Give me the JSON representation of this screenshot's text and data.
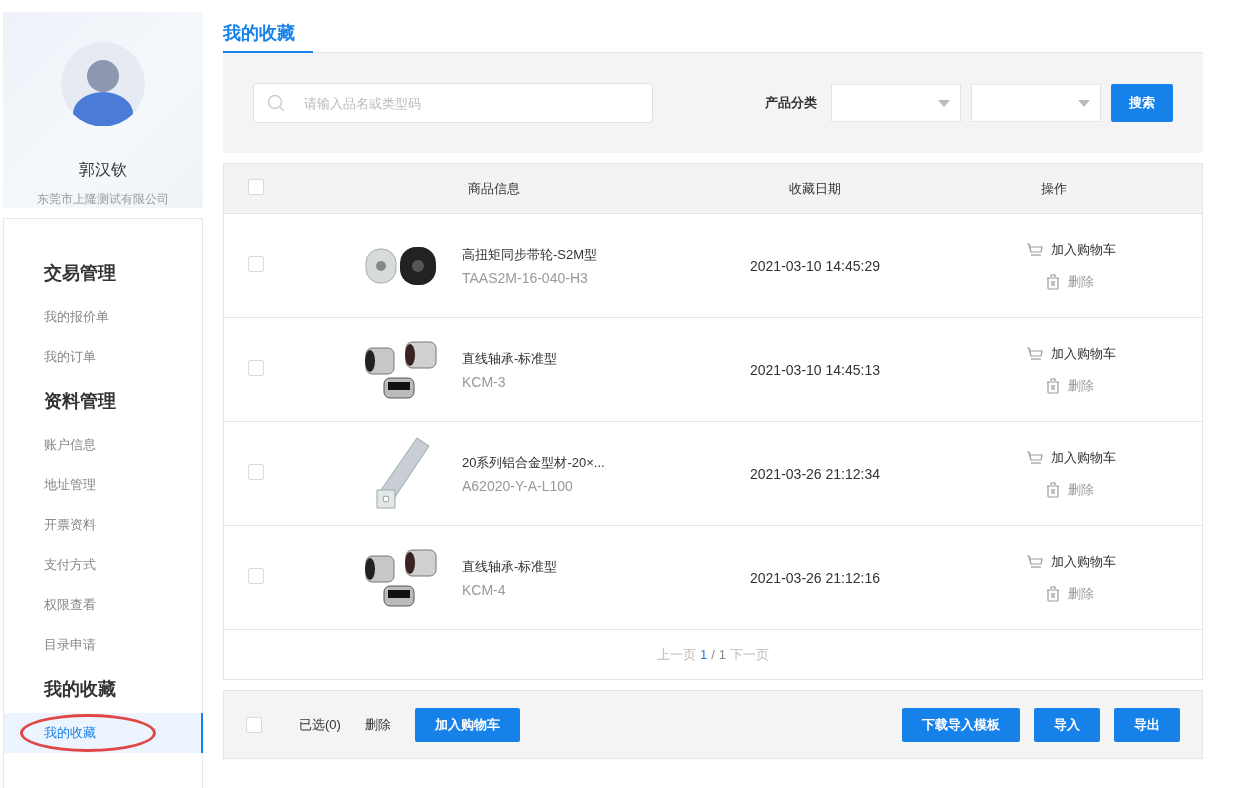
{
  "profile": {
    "name": "郭汉钦",
    "company": "东莞市上隆测试有限公司"
  },
  "menu": [
    {
      "title": "交易管理",
      "items": [
        {
          "label": "我的报价单",
          "selected": false
        },
        {
          "label": "我的订单",
          "selected": false
        }
      ]
    },
    {
      "title": "资料管理",
      "items": [
        {
          "label": "账户信息",
          "selected": false
        },
        {
          "label": "地址管理",
          "selected": false
        },
        {
          "label": "开票资料",
          "selected": false
        },
        {
          "label": "支付方式",
          "selected": false
        },
        {
          "label": "权限查看",
          "selected": false
        },
        {
          "label": "目录申请",
          "selected": false
        }
      ]
    },
    {
      "title": "我的收藏",
      "items": [
        {
          "label": "我的收藏",
          "selected": true,
          "annotated": true
        }
      ]
    }
  ],
  "page_tab": "我的收藏",
  "search": {
    "placeholder": "请输入品名或类型码",
    "category_label": "产品分类",
    "button": "搜索"
  },
  "table": {
    "select_all_checked": false,
    "columns": [
      "商品信息",
      "收藏日期",
      "操作"
    ],
    "rows": [
      {
        "checked": false,
        "kind": "pulley",
        "name": "高扭矩同步带轮-S2M型",
        "code": "TAAS2M-16-040-H3",
        "date": "2021-03-10 14:45:29",
        "add_cart": "加入购物车",
        "delete": "删除"
      },
      {
        "checked": false,
        "kind": "bearing",
        "name": "直线轴承-标准型",
        "code": "KCM-3",
        "date": "2021-03-10 14:45:13",
        "add_cart": "加入购物车",
        "delete": "删除"
      },
      {
        "checked": false,
        "kind": "profile",
        "name": "20系列铝合金型材-20×...",
        "code": "A62020-Y-A-L100",
        "date": "2021-03-26 21:12:34",
        "add_cart": "加入购物车",
        "delete": "删除"
      },
      {
        "checked": false,
        "kind": "bearing",
        "name": "直线轴承-标准型",
        "code": "KCM-4",
        "date": "2021-03-26 21:12:16",
        "add_cart": "加入购物车",
        "delete": "删除"
      }
    ],
    "pager": {
      "prev": "上一页",
      "current": "1",
      "separator": "/",
      "total": "1",
      "next": "下一页"
    }
  },
  "footer": {
    "checked": false,
    "selected_count": "已选(0)",
    "delete": "删除",
    "add_cart": "加入购物车",
    "buttons": [
      "下载导入模板",
      "导入",
      "导出"
    ]
  }
}
